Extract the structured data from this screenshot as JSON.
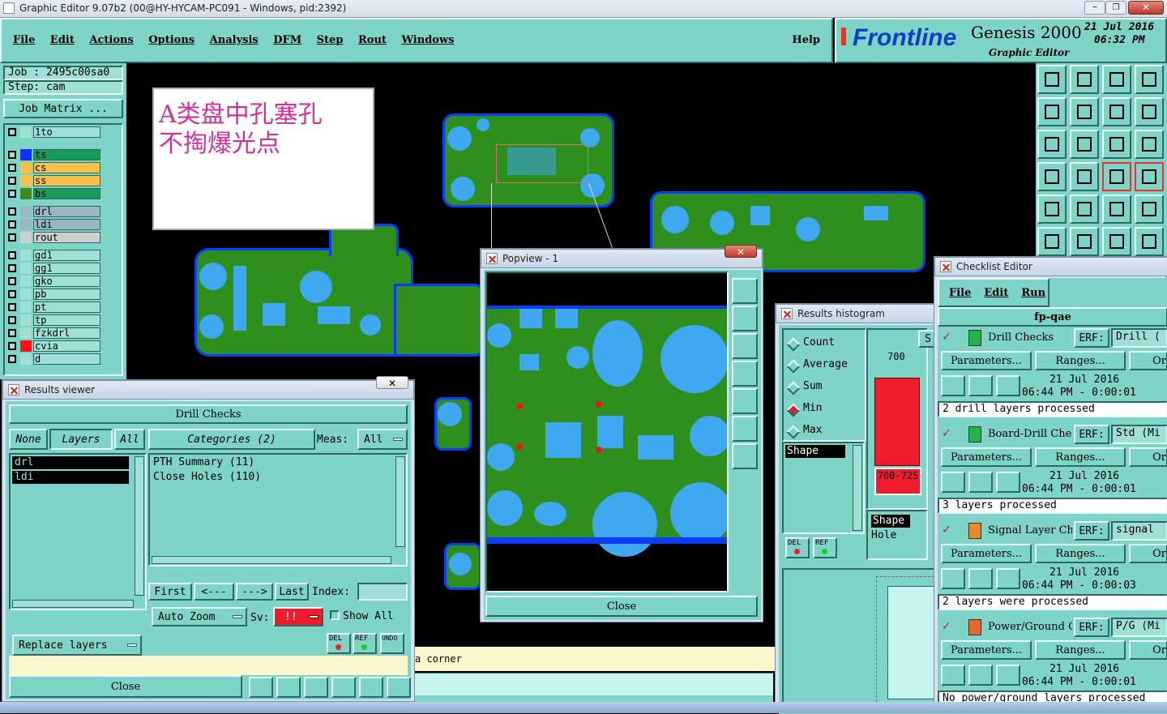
{
  "window": {
    "title": "Graphic Editor 9.07b2 (00@HY-HYCAM-PC091 - Windows, pid:2392)"
  },
  "menu": {
    "items": [
      "File",
      "Edit",
      "Actions",
      "Options",
      "Analysis",
      "DFM",
      "Step",
      "Rout",
      "Windows"
    ],
    "help": "Help"
  },
  "brand": {
    "logo": "Frontline",
    "product": "Genesis 2000",
    "subtitle": "Graphic Editor",
    "date": "21 Jul 2016",
    "time": "06:32 PM"
  },
  "job": {
    "job_label": "Job : 2495c00sa0",
    "step_label": "Step: cam",
    "matrix_button": "Job Matrix ..."
  },
  "layers": [
    {
      "name": "1to",
      "color": "#9fe0d6"
    },
    {
      "name": "ts",
      "color": "#1a9a5a",
      "swatch": "#1030ff"
    },
    {
      "name": "cs",
      "color": "#f6c04a"
    },
    {
      "name": "ss",
      "color": "#f6c04a"
    },
    {
      "name": "bs",
      "color": "#1a9a5a",
      "swatch": "#3b8a1a"
    },
    {
      "name": "drl",
      "color": "#9ab8c4"
    },
    {
      "name": "ldi",
      "color": "#9ab8c4"
    },
    {
      "name": "rout",
      "color": "#cfcfcf"
    },
    {
      "name": "gd1",
      "color": "#9fe0d6"
    },
    {
      "name": "gg1",
      "color": "#9fe0d6"
    },
    {
      "name": "gko",
      "color": "#9fe0d6"
    },
    {
      "name": "pb",
      "color": "#9fe0d6"
    },
    {
      "name": "pt",
      "color": "#9fe0d6"
    },
    {
      "name": "tp",
      "color": "#9fe0d6"
    },
    {
      "name": "fzkdrl",
      "color": "#9fe0d6"
    },
    {
      "name": "cvia",
      "color": "#9fe0d6",
      "swatch": "#ff1010"
    },
    {
      "name": "d",
      "color": "#9fe0d6"
    }
  ],
  "note": {
    "line1": "A类盘中孔塞孔",
    "line2": "不掏爆光点"
  },
  "results_viewer": {
    "title": "Results viewer",
    "header": "Drill Checks",
    "tabs": [
      "None",
      "Layers",
      "All"
    ],
    "categories": "Categories (2)",
    "meas_label": "Meas:",
    "meas_value": "All",
    "layer_list": [
      "drl",
      "ldi"
    ],
    "category_list": [
      "PTH Summary (11)",
      "Close Holes (110)"
    ],
    "nav": [
      "First",
      "<---",
      "--->",
      "Last"
    ],
    "index_label": "Index:",
    "auto_zoom": "Auto Zoom",
    "sv_label": "Sv:",
    "sv_value": "!!",
    "show_all": "Show All",
    "replace_layers": "Replace layers",
    "close": "Close",
    "del": "DEL",
    "ref": "REF",
    "undo": "UNDO"
  },
  "status": {
    "message": "a corner"
  },
  "popview": {
    "title": "Popview - 1",
    "close": "Close"
  },
  "histogram": {
    "title": "Results histogram",
    "stats": [
      "Count",
      "Average",
      "Sum",
      "Min",
      "Max"
    ],
    "selected_stat": "Min",
    "list_items": [
      "Shape"
    ],
    "bar_label": "700",
    "range_label": "700-725",
    "bar_level": 0.85,
    "legend": [
      "Shape",
      "Hole"
    ],
    "del": "DEL",
    "ref": "REF",
    "s_button": "S"
  },
  "checklist": {
    "title": "Checklist Editor",
    "menu": [
      "File",
      "Edit",
      "Run"
    ],
    "name": "fp-qae",
    "erf_label": "ERF:",
    "params_label": "Parameters...",
    "ranges_label": "Ranges...",
    "o_label": "Or",
    "items": [
      {
        "name": "Drill Checks",
        "erf": "Drill (",
        "date": "21 Jul 2016",
        "time": "06:44 PM - 0:00:01",
        "status": "2 drill layers processed",
        "icon_color": "#22b34a"
      },
      {
        "name": "Board-Drill Che",
        "erf": "Std (Mi",
        "date": "21 Jul 2016",
        "time": "06:44 PM - 0:00:01",
        "status": "3 layers processed",
        "icon_color": "#22b34a"
      },
      {
        "name": "Signal Layer Ch",
        "erf": "signal",
        "date": "21 Jul 2016",
        "time": "06:44 PM - 0:00:03",
        "status": "2 layers were processed",
        "icon_color": "#e88a2a"
      },
      {
        "name": "Power/Ground C",
        "erf": "P/G (Mi",
        "date": "21 Jul 2016",
        "time": "06:44 PM - 0:00:01",
        "status": "No power/ground layers processed",
        "icon_color": "#e86a2a"
      }
    ]
  }
}
